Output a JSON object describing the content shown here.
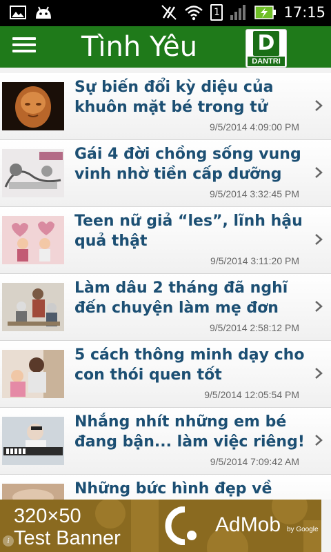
{
  "status_bar": {
    "time": "17:15",
    "sim": "1"
  },
  "app_bar": {
    "title": "Tình Yêu",
    "logo_letter": "D",
    "logo_text": "DANTRI"
  },
  "articles": [
    {
      "title": "Sự biến đổi kỳ diệu của khuôn mặt bé trong tử cung người",
      "time": "9/5/2014 4:09:00 PM"
    },
    {
      "title": "Gái 4 đời chồng sống vung vinh nhờ tiền cấp dưỡng nuô…",
      "time": "9/5/2014 3:32:45 PM"
    },
    {
      "title": "Teen nữ giả “les”, lĩnh hậu quả thật",
      "time": "9/5/2014 3:11:20 PM"
    },
    {
      "title": "Làm dâu 2 tháng đã nghĩ đến chuyện làm mẹ đơn thân",
      "time": "9/5/2014 2:58:12 PM"
    },
    {
      "title": "5 cách thông minh dạy cho con thói quen tốt",
      "time": "9/5/2014 12:05:54 PM"
    },
    {
      "title": "Nhắng nhít những em bé đang bận... làm việc riêng!",
      "time": "9/5/2014 7:09:42 AM"
    },
    {
      "title": "Những bức hình đẹp về tình",
      "time": ""
    }
  ],
  "ad": {
    "size_label": "320×50",
    "label": "Test Banner",
    "brand": "AdMob",
    "by": "by Google",
    "info": "i"
  },
  "colors": {
    "app_bar": "#1f7a1a",
    "title_text": "#1c4f73",
    "ad_bg": "#8a6a20"
  }
}
